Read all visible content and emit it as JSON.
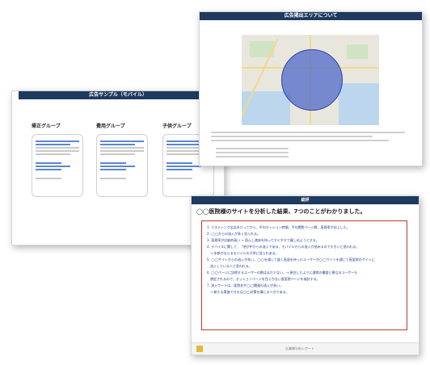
{
  "slide1": {
    "title": "広告サンプル（モバイル）",
    "groups": [
      {
        "name": "帰正グループ"
      },
      {
        "name": "費用グループ"
      },
      {
        "name": "子供グループ"
      }
    ]
  },
  "slide2": {
    "title": "広告掲出エリアについて"
  },
  "slide3": {
    "title": "総評",
    "headline": "◯◯医院様のサイトを分析した結果、7つのことがわかりました。",
    "items": [
      "1. リスティング広告をだってから、平均セッション時間、平均閲覧ページ数、直帰率が向上した。",
      "2. ◯◯からの流入が多く見られる。",
      "3. 直帰率が比較的高い → 読んし満体を持ってすぐやすて離しめようとする。",
      "4. デバイスに関して、「他が中からの流入である、モバイルからの流入が他みるのですきいと思われる。",
      "　→ 年齢がならるモバイルの子供に見られある。",
      "5. ◯◯サイトからの流入が多い。◯◯を通して誰く直面を持ったユーザーが◯◯サイトを通じて直医院のサイトに",
      "　流入している人と思われる。",
      "6. ◯◯ページに訪問するユーザーの数はまだ少ない。→ 原住したように通常の書査と異なるユーザーも",
      "　想定されるので、セッションページを目ぐかない直医院ページを検討する。",
      "7. 流入ワードは、医院名や◯◯関連の流入が多い。",
      "　→ 新たな実施できるな◯◯対策を講じるべきである。"
    ],
    "footer_page": "企業様分析レポート"
  }
}
